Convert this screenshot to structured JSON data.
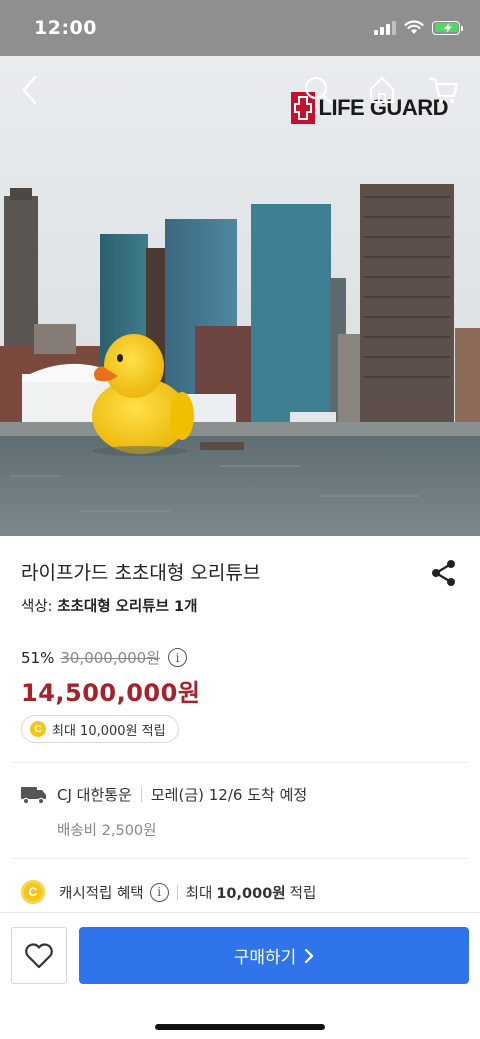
{
  "status_bar": {
    "time": "12:00"
  },
  "header": {
    "logo_text": "LIFE GUARD"
  },
  "product": {
    "title": "라이프가드 초초대형 오리튜브",
    "option_label": "색상:",
    "option_value": "초초대형 오리튜브 1개",
    "discount_rate": "51%",
    "original_price": "30,000,000원",
    "sale_price": "14,500,000원",
    "points_badge": "최대 10,000원 적립"
  },
  "delivery": {
    "courier": "CJ 대한통운",
    "arrival": "모레(금) 12/6 도착 예정",
    "shipping_fee": "배송비 2,500원"
  },
  "cashback": {
    "label": "캐시적립 혜택",
    "prefix": "최대",
    "amount": "10,000원",
    "suffix": "적립"
  },
  "bottom_bar": {
    "buy_label": "구매하기"
  },
  "colors": {
    "sale_price": "#a8202a",
    "buy_button": "#2f74ea",
    "coin": "#f5c518"
  },
  "icons": [
    "back-icon",
    "search-icon",
    "home-icon",
    "cart-icon",
    "share-icon",
    "info-icon",
    "coin-icon",
    "truck-icon",
    "heart-icon",
    "chevron-right-icon"
  ]
}
